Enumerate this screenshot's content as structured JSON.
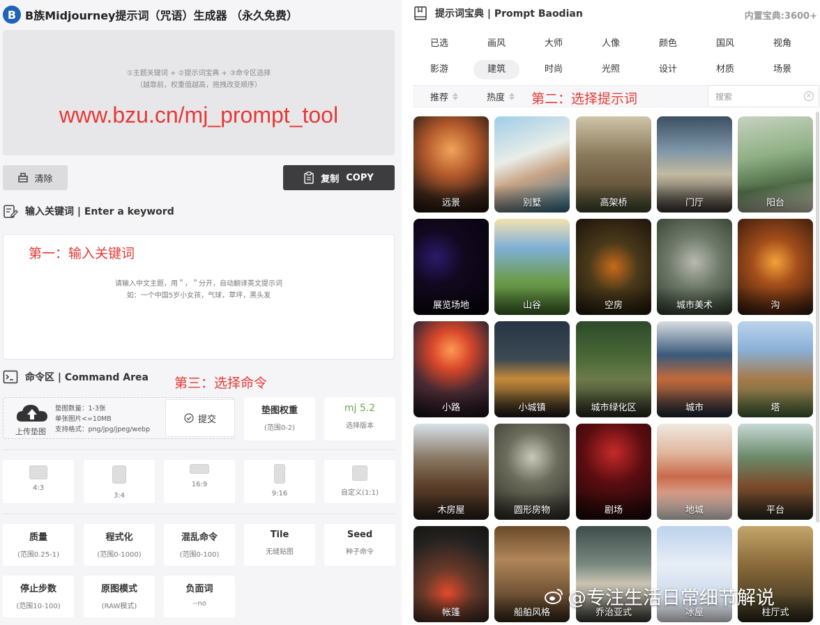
{
  "app": {
    "logo": "B",
    "title": "B族Midjourney提示词（咒语）生成器 （永久免费）"
  },
  "prompt_area": {
    "hint_line1": "①主题关键词 + ②提示词宝典 + ③命令区选择",
    "hint_line2": "（越靠前，权重值越高，拖拽改变顺序）",
    "url": "www.bzu.cn/mj_prompt_tool"
  },
  "buttons": {
    "clear_label": "清除",
    "copy_label": "复制",
    "copy_label_en": "COPY"
  },
  "keyword": {
    "title": "输入关键词 | Enter a keyword",
    "annotation": "第一：输入关键词",
    "placeholder_line1": "请输入中文主题，用＂，＂分开，自动翻译英文提示词",
    "placeholder_line2": "如：一个中国5岁小女孩，气球，草坪，黑头发"
  },
  "command": {
    "title": "命令区 | Command Area",
    "annotation": "第三：选择命令",
    "upload": {
      "label": "上传垫图",
      "info": [
        "垫图数量：1-3张",
        "单张图片<=10MB",
        "支持格式：png/jpg/jpeg/webp"
      ],
      "submit": "提交"
    },
    "image_weight": {
      "main": "垫图权重",
      "sub": "(范围0-2)"
    },
    "version": {
      "main": "mj 5.2",
      "sub": "选择版本"
    },
    "aspect_ratios": [
      "4:3",
      "3:4",
      "16:9",
      "9:16",
      "自定义(1:1)"
    ],
    "params_row1": [
      {
        "main": "质量",
        "sub": "(范围0.25-1)"
      },
      {
        "main": "程式化",
        "sub": "(范围0-1000)"
      },
      {
        "main": "混乱命令",
        "sub": "(范围0-100)"
      },
      {
        "main": "Tile",
        "sub": "无缝贴图"
      },
      {
        "main": "Seed",
        "sub": "种子命令"
      }
    ],
    "params_row2": [
      {
        "main": "停止步数",
        "sub": "(范围10-100)"
      },
      {
        "main": "原图模式",
        "sub": "(RAW模式)"
      },
      {
        "main": "负面词",
        "sub": "--no"
      }
    ]
  },
  "baodian": {
    "title": "提示词宝典 | Prompt Baodian",
    "count": "内置宝典:3600+",
    "annotation": "第二：选择提示词",
    "tabs_row1": [
      "已选",
      "画风",
      "大师",
      "人像",
      "颜色",
      "国风",
      "视角"
    ],
    "tabs_row2": [
      "影游",
      "建筑",
      "时尚",
      "光照",
      "设计",
      "材质",
      "场景"
    ],
    "active_tab": "建筑",
    "sort": [
      "推荐",
      "热度"
    ],
    "search_placeholder": "搜索",
    "tiles": [
      "远景",
      "别墅",
      "高架桥",
      "门厅",
      "阳台",
      "展览场地",
      "山谷",
      "空房",
      "城市美术",
      "沟",
      "小路",
      "小城镇",
      "城市绿化区",
      "城市",
      "塔",
      "木房屋",
      "圆形房物",
      "剧场",
      "地城",
      "平台",
      "帐篷",
      "船舶风格",
      "乔治亚式",
      "冰屋",
      "柱厅式"
    ]
  },
  "watermark": "@专注生活日常细节解说"
}
